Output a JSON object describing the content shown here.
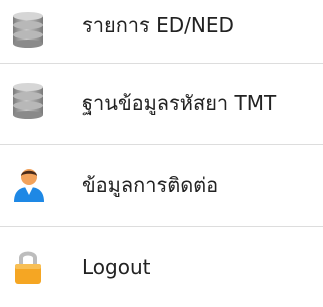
{
  "menu": {
    "items": [
      {
        "label": "รายการ ED/NED",
        "icon": "database-icon"
      },
      {
        "label": "ฐานข้อมูลรหัสยา TMT",
        "icon": "database-icon"
      },
      {
        "label": "ข้อมูลการติดต่อ",
        "icon": "user-icon"
      },
      {
        "label": "Logout",
        "icon": "lock-icon"
      }
    ]
  },
  "colors": {
    "text": "#222222",
    "divider": "#dddddd",
    "database_gray": "#9a9a9a",
    "user_blue": "#1e88e5",
    "user_skin": "#f2a25b",
    "lock_orange": "#f5a623"
  }
}
